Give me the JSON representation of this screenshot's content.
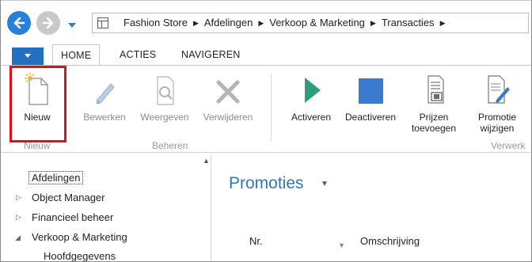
{
  "breadcrumb": [
    "Fashion Store",
    "Afdelingen",
    "Verkoop & Marketing",
    "Transacties"
  ],
  "ribbon_tabs": [
    "HOME",
    "ACTIES",
    "NAVIGEREN"
  ],
  "active_tab": "HOME",
  "ribbon": {
    "nieuw": "Nieuw",
    "bewerken": "Bewerken",
    "weergeven": "Weergeven",
    "verwijderen": "Verwijderen",
    "activeren": "Activeren",
    "deactiveren": "Deactiveren",
    "prijzen_line1": "Prijzen",
    "prijzen_line2": "toevoegen",
    "promotie_line1": "Promotie",
    "promotie_line2": "wijzigen",
    "groups": [
      "Nieuw",
      "Beheren",
      "Verwerk"
    ]
  },
  "nav": {
    "items": [
      {
        "label": "Afdelingen"
      },
      {
        "label": "Object Manager"
      },
      {
        "label": "Financieel beheer"
      },
      {
        "label": "Verkoop & Marketing"
      },
      {
        "label": "Hoofdgegevens"
      }
    ]
  },
  "content": {
    "title": "Promoties",
    "columns": [
      "Nr.",
      "Omschrijving"
    ]
  },
  "colors": {
    "accent": "#2a7fd8",
    "ribbon_tab_blue": "#2470c0",
    "activate_green": "#2e9c7e",
    "deactivate_blue": "#3a7bd0",
    "highlight_red": "#e0101a",
    "title_blue": "#2a7ab8"
  }
}
